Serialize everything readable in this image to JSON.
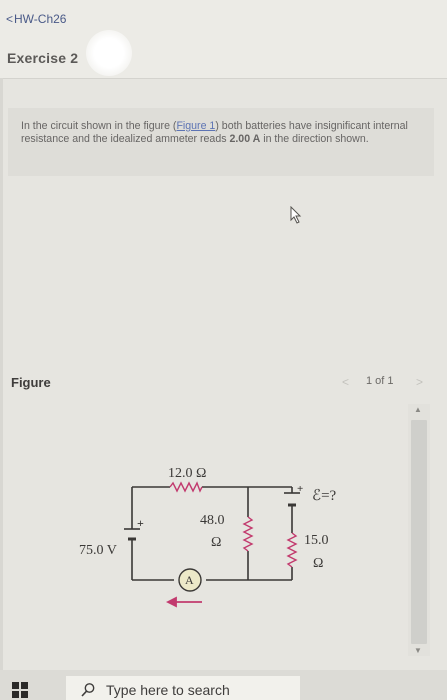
{
  "header": {
    "back_label": "HW-Ch26",
    "exercise_title": "Exercise 2"
  },
  "problem": {
    "text_before_link": "In the circuit shown in the figure (",
    "link_label": "Figure 1",
    "text_after_link": ") both batteries have insignificant internal resistance and the idealized ammeter reads ",
    "current_value": "2.00 A",
    "text_end": " in the direction shown."
  },
  "figure": {
    "label": "Figure",
    "pager": {
      "prev": "<",
      "count": "1 of 1",
      "next": ">"
    },
    "circuit": {
      "r_top": "12.0 Ω",
      "r_middle_value": "48.0",
      "r_middle_unit": "Ω",
      "r_right_value": "15.0",
      "r_right_unit": "Ω",
      "battery_left": "75.0 V",
      "battery_right": "ℰ=?",
      "ammeter": "A",
      "plus_left": "+",
      "plus_right": "+"
    }
  },
  "taskbar": {
    "search_placeholder": "Type here to search"
  },
  "icons": {
    "back": "chevron-left-icon",
    "cursor": "pointer-cursor-icon",
    "start": "windows-start-icon",
    "search": "search-icon"
  }
}
